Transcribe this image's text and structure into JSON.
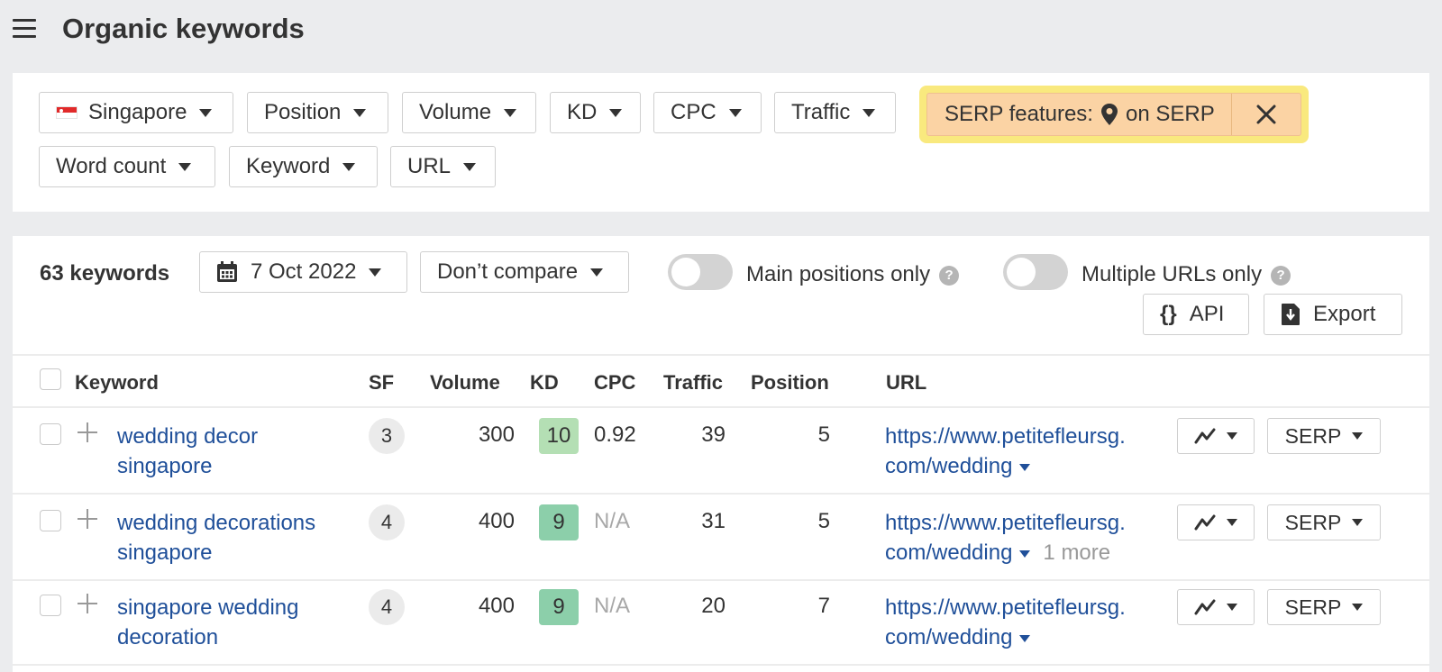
{
  "header": {
    "title": "Organic keywords",
    "menu_icon": "hamburger-menu-icon"
  },
  "filters": {
    "country": "Singapore",
    "country_flag": "singapore-flag-icon",
    "buttons": [
      "Position",
      "Volume",
      "KD",
      "CPC",
      "Traffic",
      "Word count",
      "Keyword",
      "URL"
    ],
    "active_filter": {
      "label_prefix": "SERP features:",
      "icon": "map-pin-icon",
      "label_suffix": "on SERP",
      "close_icon": "close-icon",
      "highlight_color": "#f9e97e",
      "chip_color": "#fbd3a4"
    }
  },
  "results": {
    "count_label": "63 keywords",
    "date": "7 Oct 2022",
    "compare": "Don’t compare",
    "toggle_main_positions": {
      "label": "Main positions only",
      "on": false
    },
    "toggle_multiple_urls": {
      "label": "Multiple URLs only",
      "on": false
    },
    "api_label": "API",
    "export_label": "Export"
  },
  "table": {
    "columns": {
      "keyword": "Keyword",
      "sf": "SF",
      "volume": "Volume",
      "kd": "KD",
      "cpc": "CPC",
      "traffic": "Traffic",
      "position": "Position",
      "url": "URL"
    },
    "rows": [
      {
        "keyword_line1": "wedding decor",
        "keyword_line2": "singapore",
        "sf": "3",
        "volume": "300",
        "kd": "10",
        "kd_color": "#b4dfb4",
        "cpc": "0.92",
        "traffic": "39",
        "position": "5",
        "url_line1": "https://www.petitefleursg.",
        "url_line2": "com/wedding",
        "more": "",
        "serp_label": "SERP"
      },
      {
        "keyword_line1": "wedding decorations",
        "keyword_line2": "singapore",
        "sf": "4",
        "volume": "400",
        "kd": "9",
        "kd_color": "#8ccfaa",
        "cpc": "N/A",
        "traffic": "31",
        "position": "5",
        "url_line1": "https://www.petitefleursg.",
        "url_line2": "com/wedding",
        "more": "1 more",
        "serp_label": "SERP"
      },
      {
        "keyword_line1": "singapore wedding",
        "keyword_line2": "decoration",
        "sf": "4",
        "volume": "400",
        "kd": "9",
        "kd_color": "#8ccfaa",
        "cpc": "N/A",
        "traffic": "20",
        "position": "7",
        "url_line1": "https://www.petitefleursg.",
        "url_line2": "com/wedding",
        "more": "",
        "serp_label": "SERP"
      }
    ]
  }
}
